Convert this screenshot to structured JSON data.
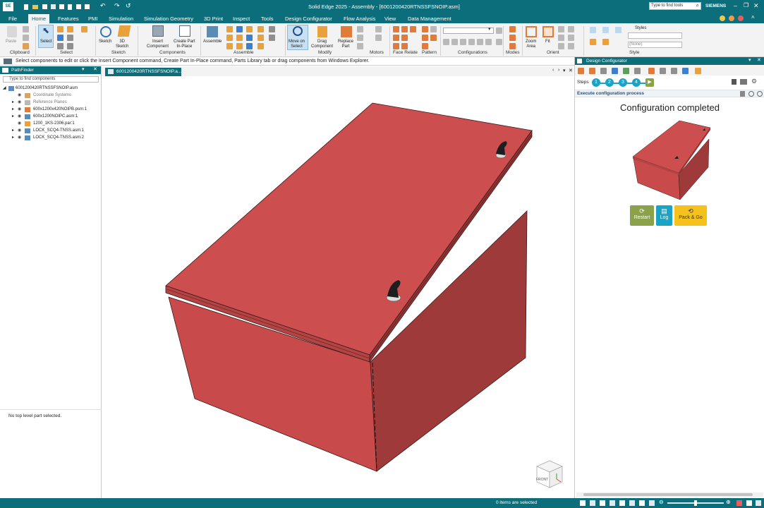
{
  "window": {
    "title": "Solid Edge 2025 - Assembly - [6001200420RTNSSFSNOIP.asm]",
    "brand": "SIEMENS",
    "search_placeholder": "Type to find tools"
  },
  "menu": {
    "items": [
      "File",
      "Home",
      "Features",
      "PMI",
      "Simulation",
      "Simulation Geometry",
      "3D Print",
      "Inspect",
      "Tools",
      "Design Configurator",
      "Flow Analysis",
      "View",
      "Data Management"
    ],
    "active": "Home"
  },
  "ribbon": {
    "groups": [
      "Clipboard",
      "Select",
      "Sketch",
      "Components",
      "Assemble",
      "Modify",
      "Motors",
      "Face Relate",
      "Pattern",
      "Configurations",
      "Modes",
      "Orient",
      "Style"
    ],
    "buttons": {
      "paste": "Paste",
      "select": "Select",
      "sketch": "Sketch",
      "sketch3d": "3D\nSketch",
      "insert_component": "Insert\nComponent",
      "create_part": "Create Part\nIn-Place",
      "assemble": "Assemble",
      "move_on_select": "Move on\nSelect",
      "drag_component": "Drag\nComponent",
      "replace_part": "Replace\nPart",
      "zoom_area": "Zoom\nArea",
      "fit": "Fit"
    },
    "styles_label": "Styles",
    "style_value": "(None)"
  },
  "prompt": {
    "text": "Select components to edit or click the Insert Component command, Create Part In-Place command, Parts Library tab or drag components from Windows Explorer."
  },
  "pathfinder": {
    "title": "PathFinder",
    "search_placeholder": "Type to find components",
    "root": "6001200420RTNSSFSNOIP.asm",
    "items": [
      "Coordinate Systems",
      "Reference Planes",
      "600x1200x420NOIPB.psm:1",
      "600x1200NOIPC.asm:1",
      "1200_1KS-2306.par:1",
      "LOCK_SCQ4-TNSS.asm:1",
      "LOCK_SCQ4-TNSS.asm:2"
    ],
    "empty_message": "No top level part selected."
  },
  "document_tab": {
    "label": "6001200420RTNSSFSNOIP.a..."
  },
  "view_cube": {
    "label": "FRONT"
  },
  "design_configurator": {
    "title": "Design Configurator",
    "steps_label": "Steps",
    "steps": [
      "1",
      "2",
      "3",
      "4"
    ],
    "execute_label": "Execute configuration process",
    "status_heading": "Configuration completed",
    "buttons": {
      "restart": "Restart",
      "log": "Log",
      "pack_go": "Pack & Go"
    }
  },
  "statusbar": {
    "selection_text": "0 items are selected"
  },
  "colors": {
    "accent": "#0b6e7a",
    "box_red": "#c84a4a",
    "restart": "#8ca24a",
    "log": "#1aa3c4",
    "pack_go": "#f4c21b"
  }
}
